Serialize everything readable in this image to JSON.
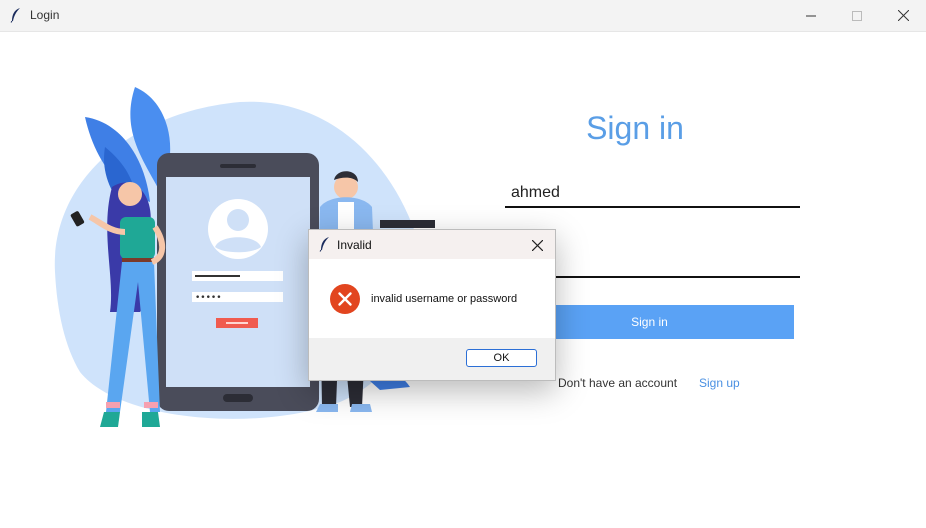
{
  "window": {
    "title": "Login",
    "icons": {
      "app": "feather-icon",
      "minimize": "minimize-icon",
      "maximize": "maximize-icon",
      "close": "close-icon"
    }
  },
  "login": {
    "title": "Sign in",
    "username_value": "ahmed",
    "password_value": "",
    "signin_label": "Sign in",
    "no_account_text": "Don't have an account",
    "signup_link": "Sign up",
    "accent_color": "#5aa2f5"
  },
  "illustration": {
    "mock_password": "•••••"
  },
  "dialog": {
    "title": "Invalid",
    "message": "invalid username or password",
    "ok_label": "OK",
    "icon": "error-icon"
  }
}
